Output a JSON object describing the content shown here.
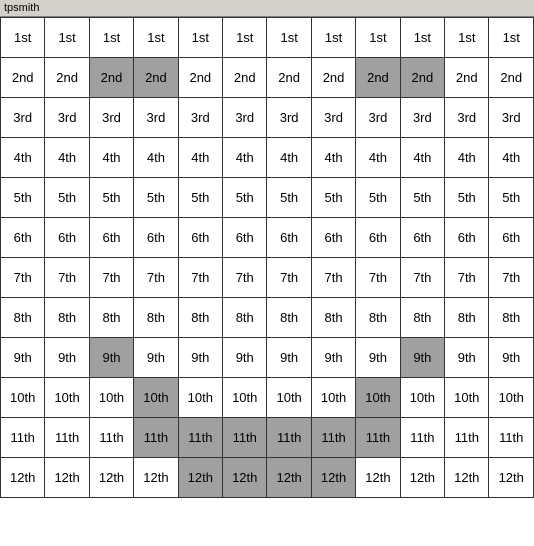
{
  "title": "tpsmith",
  "grid": {
    "rows": [
      {
        "label": "1st",
        "cells": [
          {
            "value": "1st",
            "highlight": false
          },
          {
            "value": "1st",
            "highlight": false
          },
          {
            "value": "1st",
            "highlight": false
          },
          {
            "value": "1st",
            "highlight": false
          },
          {
            "value": "1st",
            "highlight": false
          },
          {
            "value": "1st",
            "highlight": false
          },
          {
            "value": "1st",
            "highlight": false
          },
          {
            "value": "1st",
            "highlight": false
          },
          {
            "value": "1st",
            "highlight": false
          },
          {
            "value": "1st",
            "highlight": false
          },
          {
            "value": "1st",
            "highlight": false
          },
          {
            "value": "1st",
            "highlight": false
          }
        ]
      },
      {
        "label": "2nd",
        "cells": [
          {
            "value": "2nd",
            "highlight": false
          },
          {
            "value": "2nd",
            "highlight": false
          },
          {
            "value": "2nd",
            "highlight": true
          },
          {
            "value": "2nd",
            "highlight": true
          },
          {
            "value": "2nd",
            "highlight": false
          },
          {
            "value": "2nd",
            "highlight": false
          },
          {
            "value": "2nd",
            "highlight": false
          },
          {
            "value": "2nd",
            "highlight": false
          },
          {
            "value": "2nd",
            "highlight": true
          },
          {
            "value": "2nd",
            "highlight": true
          },
          {
            "value": "2nd",
            "highlight": false
          },
          {
            "value": "2nd",
            "highlight": false
          }
        ]
      },
      {
        "label": "3rd",
        "cells": [
          {
            "value": "3rd",
            "highlight": false
          },
          {
            "value": "3rd",
            "highlight": false
          },
          {
            "value": "3rd",
            "highlight": false
          },
          {
            "value": "3rd",
            "highlight": false
          },
          {
            "value": "3rd",
            "highlight": false
          },
          {
            "value": "3rd",
            "highlight": false
          },
          {
            "value": "3rd",
            "highlight": false
          },
          {
            "value": "3rd",
            "highlight": false
          },
          {
            "value": "3rd",
            "highlight": false
          },
          {
            "value": "3rd",
            "highlight": false
          },
          {
            "value": "3rd",
            "highlight": false
          },
          {
            "value": "3rd",
            "highlight": false
          }
        ]
      },
      {
        "label": "4th",
        "cells": [
          {
            "value": "4th",
            "highlight": false
          },
          {
            "value": "4th",
            "highlight": false
          },
          {
            "value": "4th",
            "highlight": false
          },
          {
            "value": "4th",
            "highlight": false
          },
          {
            "value": "4th",
            "highlight": false
          },
          {
            "value": "4th",
            "highlight": false
          },
          {
            "value": "4th",
            "highlight": false
          },
          {
            "value": "4th",
            "highlight": false
          },
          {
            "value": "4th",
            "highlight": false
          },
          {
            "value": "4th",
            "highlight": false
          },
          {
            "value": "4th",
            "highlight": false
          },
          {
            "value": "4th",
            "highlight": false
          }
        ]
      },
      {
        "label": "5th",
        "cells": [
          {
            "value": "5th",
            "highlight": false
          },
          {
            "value": "5th",
            "highlight": false
          },
          {
            "value": "5th",
            "highlight": false
          },
          {
            "value": "5th",
            "highlight": false
          },
          {
            "value": "5th",
            "highlight": false
          },
          {
            "value": "5th",
            "highlight": false
          },
          {
            "value": "5th",
            "highlight": false
          },
          {
            "value": "5th",
            "highlight": false
          },
          {
            "value": "5th",
            "highlight": false
          },
          {
            "value": "5th",
            "highlight": false
          },
          {
            "value": "5th",
            "highlight": false
          },
          {
            "value": "5th",
            "highlight": false
          }
        ]
      },
      {
        "label": "6th",
        "cells": [
          {
            "value": "6th",
            "highlight": false
          },
          {
            "value": "6th",
            "highlight": false
          },
          {
            "value": "6th",
            "highlight": false
          },
          {
            "value": "6th",
            "highlight": false
          },
          {
            "value": "6th",
            "highlight": false
          },
          {
            "value": "6th",
            "highlight": false
          },
          {
            "value": "6th",
            "highlight": false
          },
          {
            "value": "6th",
            "highlight": false
          },
          {
            "value": "6th",
            "highlight": false
          },
          {
            "value": "6th",
            "highlight": false
          },
          {
            "value": "6th",
            "highlight": false
          },
          {
            "value": "6th",
            "highlight": false
          }
        ]
      },
      {
        "label": "7th",
        "cells": [
          {
            "value": "7th",
            "highlight": false
          },
          {
            "value": "7th",
            "highlight": false
          },
          {
            "value": "7th",
            "highlight": false
          },
          {
            "value": "7th",
            "highlight": false
          },
          {
            "value": "7th",
            "highlight": false
          },
          {
            "value": "7th",
            "highlight": false
          },
          {
            "value": "7th",
            "highlight": false
          },
          {
            "value": "7th",
            "highlight": false
          },
          {
            "value": "7th",
            "highlight": false
          },
          {
            "value": "7th",
            "highlight": false
          },
          {
            "value": "7th",
            "highlight": false
          },
          {
            "value": "7th",
            "highlight": false
          }
        ]
      },
      {
        "label": "8th",
        "cells": [
          {
            "value": "8th",
            "highlight": false
          },
          {
            "value": "8th",
            "highlight": false
          },
          {
            "value": "8th",
            "highlight": false
          },
          {
            "value": "8th",
            "highlight": false
          },
          {
            "value": "8th",
            "highlight": false
          },
          {
            "value": "8th",
            "highlight": false
          },
          {
            "value": "8th",
            "highlight": false
          },
          {
            "value": "8th",
            "highlight": false
          },
          {
            "value": "8th",
            "highlight": false
          },
          {
            "value": "8th",
            "highlight": false
          },
          {
            "value": "8th",
            "highlight": false
          },
          {
            "value": "8th",
            "highlight": false
          }
        ]
      },
      {
        "label": "9th",
        "cells": [
          {
            "value": "9th",
            "highlight": false
          },
          {
            "value": "9th",
            "highlight": false
          },
          {
            "value": "9th",
            "highlight": true
          },
          {
            "value": "9th",
            "highlight": false
          },
          {
            "value": "9th",
            "highlight": false
          },
          {
            "value": "9th",
            "highlight": false
          },
          {
            "value": "9th",
            "highlight": false
          },
          {
            "value": "9th",
            "highlight": false
          },
          {
            "value": "9th",
            "highlight": false
          },
          {
            "value": "9th",
            "highlight": true
          },
          {
            "value": "9th",
            "highlight": false
          },
          {
            "value": "9th",
            "highlight": false
          }
        ]
      },
      {
        "label": "10th",
        "cells": [
          {
            "value": "10th",
            "highlight": false
          },
          {
            "value": "10th",
            "highlight": false
          },
          {
            "value": "10th",
            "highlight": false
          },
          {
            "value": "10th",
            "highlight": true
          },
          {
            "value": "10th",
            "highlight": false
          },
          {
            "value": "10th",
            "highlight": false
          },
          {
            "value": "10th",
            "highlight": false
          },
          {
            "value": "10th",
            "highlight": false
          },
          {
            "value": "10th",
            "highlight": true
          },
          {
            "value": "10th",
            "highlight": false
          },
          {
            "value": "10th",
            "highlight": false
          },
          {
            "value": "10th",
            "highlight": false
          }
        ]
      },
      {
        "label": "11th",
        "cells": [
          {
            "value": "11th",
            "highlight": false
          },
          {
            "value": "11th",
            "highlight": false
          },
          {
            "value": "11th",
            "highlight": false
          },
          {
            "value": "11th",
            "highlight": true
          },
          {
            "value": "11th",
            "highlight": true
          },
          {
            "value": "11th",
            "highlight": true
          },
          {
            "value": "11th",
            "highlight": true
          },
          {
            "value": "11th",
            "highlight": true
          },
          {
            "value": "11th",
            "highlight": true
          },
          {
            "value": "11th",
            "highlight": false
          },
          {
            "value": "11th",
            "highlight": false
          },
          {
            "value": "11th",
            "highlight": false
          }
        ]
      },
      {
        "label": "12th",
        "cells": [
          {
            "value": "12th",
            "highlight": false
          },
          {
            "value": "12th",
            "highlight": false
          },
          {
            "value": "12th",
            "highlight": false
          },
          {
            "value": "12th",
            "highlight": false
          },
          {
            "value": "12th",
            "highlight": true
          },
          {
            "value": "12th",
            "highlight": true
          },
          {
            "value": "12th",
            "highlight": true
          },
          {
            "value": "12th",
            "highlight": true
          },
          {
            "value": "12th",
            "highlight": false
          },
          {
            "value": "12th",
            "highlight": false
          },
          {
            "value": "12th",
            "highlight": false
          },
          {
            "value": "12th",
            "highlight": false
          }
        ]
      }
    ]
  }
}
